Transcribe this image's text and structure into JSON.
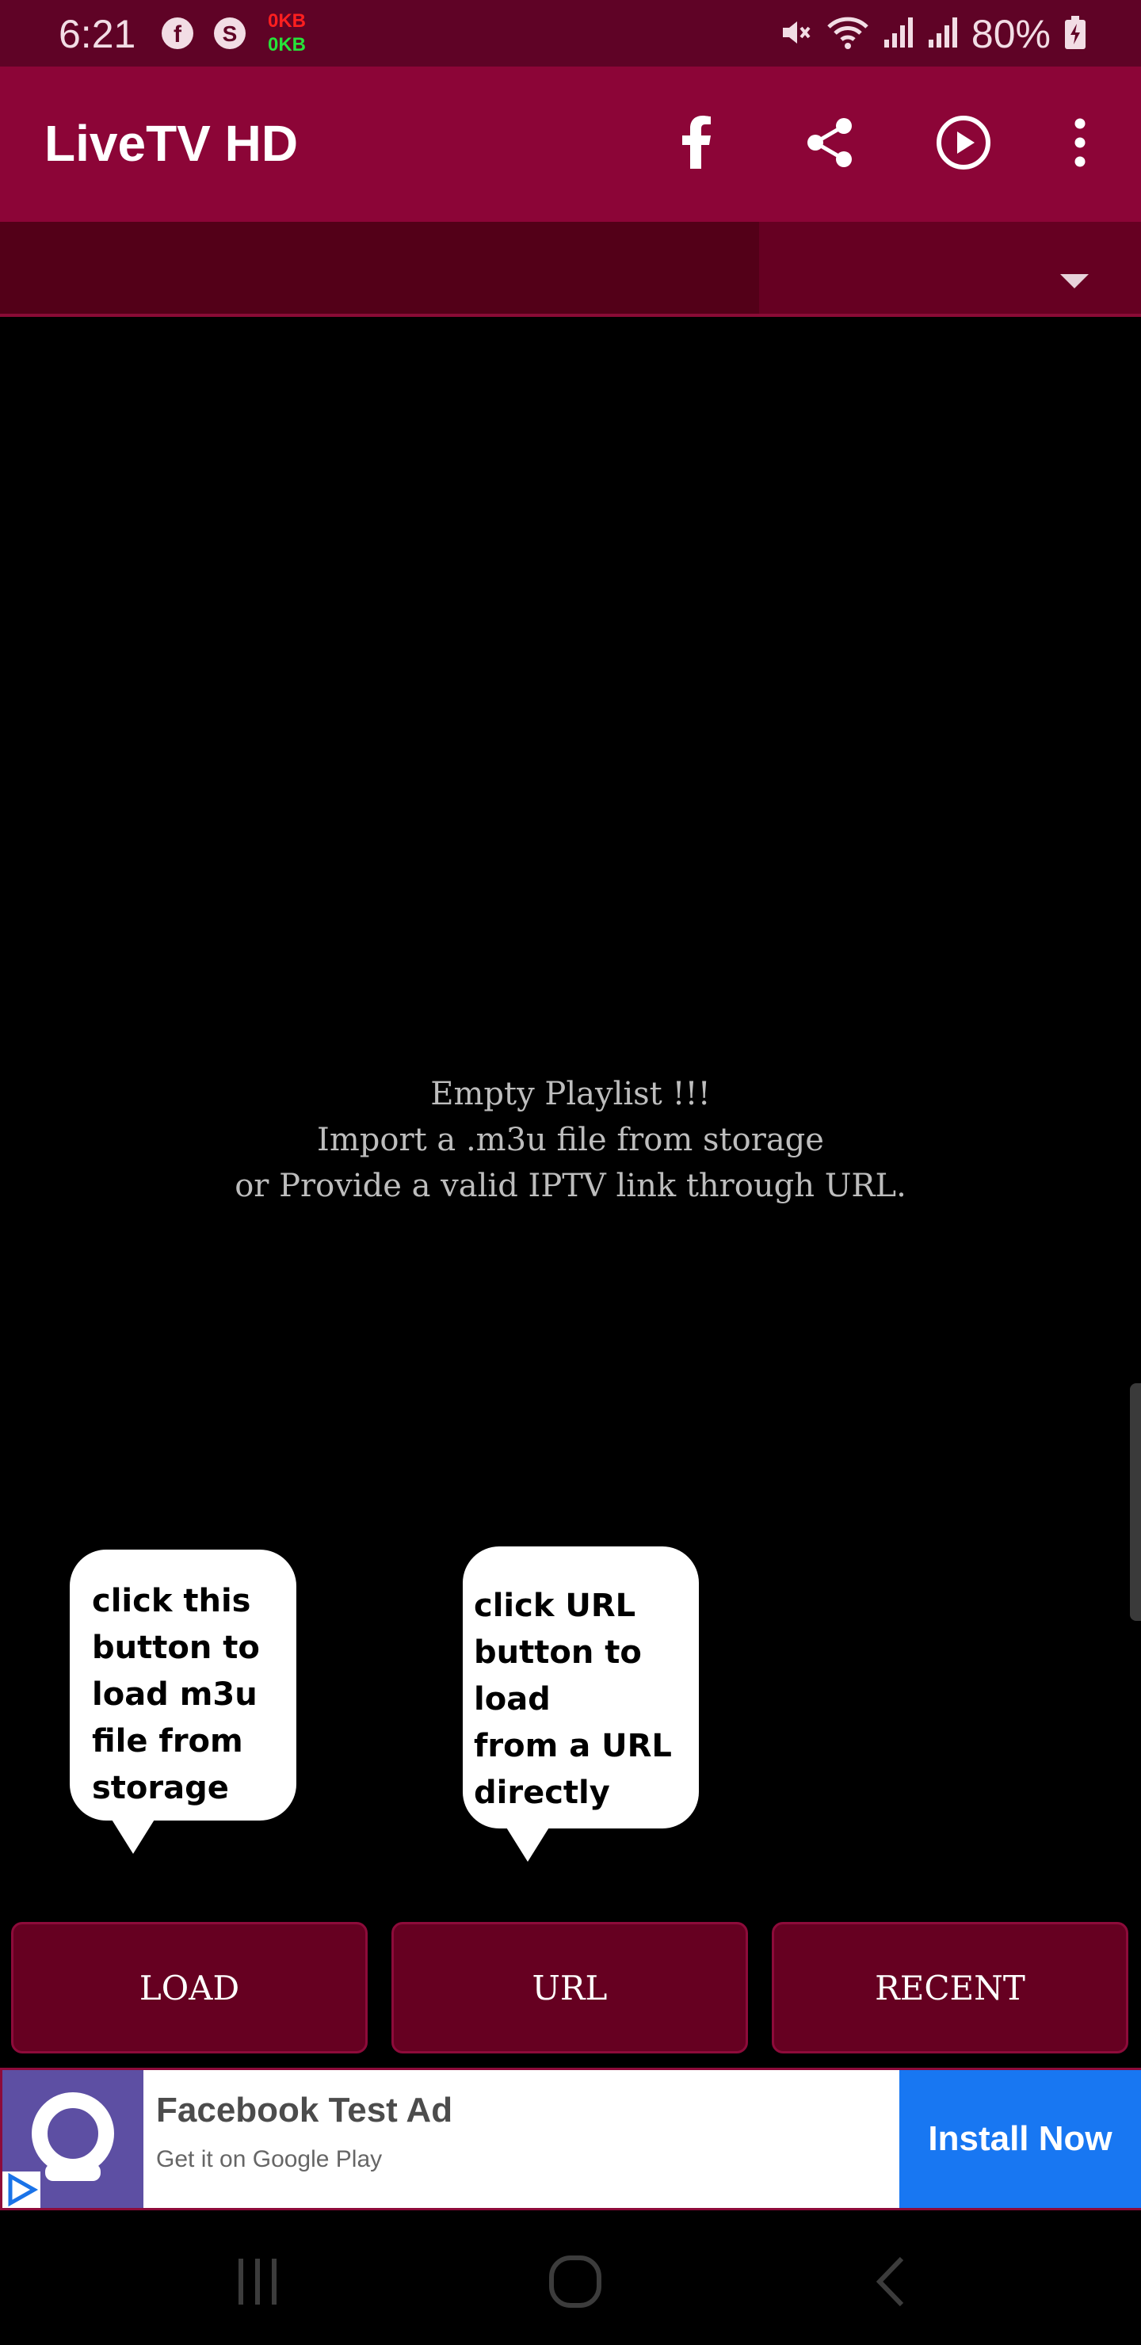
{
  "status_bar": {
    "time": "6:21",
    "kb_up": "0KB",
    "kb_down": "0KB",
    "battery": "80%",
    "icons": [
      "facebook-icon",
      "skype-icon",
      "mute-icon",
      "wifi-icon",
      "signal-icon",
      "signal-icon",
      "battery-charging-icon"
    ]
  },
  "app_bar": {
    "title": "LiveTV HD",
    "actions": [
      "facebook-icon",
      "share-icon",
      "play-circle-icon",
      "more-vert-icon"
    ]
  },
  "empty_state": {
    "line1": "Empty Playlist !!!",
    "line2": "Import a .m3u file from storage",
    "line3": "or Provide a valid IPTV link through URL."
  },
  "tips": {
    "load_tip": "click this\nbutton to\nload m3u\nfile from\nstorage",
    "url_tip": "click URL\nbutton to load\nfrom a URL\ndirectly"
  },
  "buttons": {
    "load": "LOAD",
    "url": "URL",
    "recent": "RECENT"
  },
  "ad": {
    "title": "Facebook Test Ad",
    "subtitle": "Get it on Google Play",
    "cta": "Install Now"
  },
  "colors": {
    "status_bar": "#5f0326",
    "app_bar": "#8c0537",
    "button_bg": "#660021",
    "ad_cta": "#1877f2"
  }
}
